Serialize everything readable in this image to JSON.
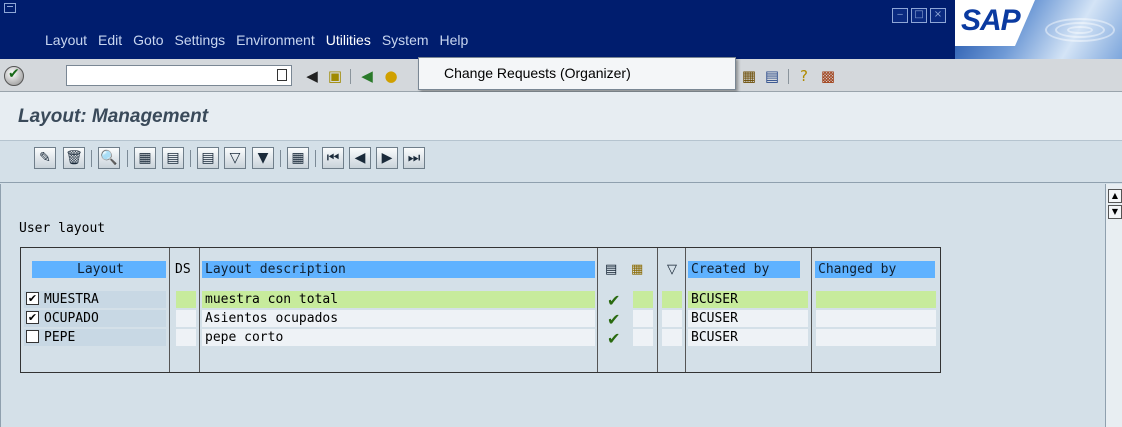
{
  "menubar": {
    "items": [
      "Layout",
      "Edit",
      "Goto",
      "Settings",
      "Environment",
      "Utilities",
      "System",
      "Help"
    ],
    "active": "Utilities",
    "window_buttons": [
      "‒",
      "□",
      "×"
    ],
    "logo": "SAP"
  },
  "dropdown": {
    "item": "Change Requests (Organizer)"
  },
  "page": {
    "title": "Layout: Management"
  },
  "content": {
    "section_label": "User layout"
  },
  "table": {
    "headers": {
      "layout": "Layout",
      "ds": "DS",
      "description": "Layout description",
      "created_by": "Created by",
      "changed_by": "Changed by"
    },
    "rows": [
      {
        "checked": true,
        "layout": "MUESTRA",
        "description": "muestra con total",
        "created_by": "BCUSER",
        "changed_by": "",
        "highlight": true
      },
      {
        "checked": true,
        "layout": "OCUPADO",
        "description": "Asientos ocupados",
        "created_by": "BCUSER",
        "changed_by": "",
        "highlight": false
      },
      {
        "checked": false,
        "layout": "PEPE",
        "description": "pepe corto",
        "created_by": "BCUSER",
        "changed_by": "",
        "highlight": false
      }
    ]
  },
  "colors": {
    "menubar": "#001d6e",
    "header_cell": "#5fb2ff",
    "selected_row": "#c7eb9c",
    "background": "#d4e0e8"
  }
}
